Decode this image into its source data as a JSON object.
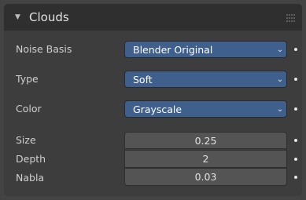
{
  "panel": {
    "title": "Clouds",
    "collapse_icon": "triangle-down-icon",
    "drag_icon": "grip-dots-icon"
  },
  "rows": {
    "noise_basis": {
      "label": "Noise Basis",
      "value": "Blender Original"
    },
    "type": {
      "label": "Type",
      "value": "Soft"
    },
    "color": {
      "label": "Color",
      "value": "Grayscale"
    },
    "size": {
      "label": "Size",
      "value": "0.25"
    },
    "depth": {
      "label": "Depth",
      "value": "2"
    },
    "nabla": {
      "label": "Nabla",
      "value": "0.03"
    }
  },
  "glyphs": {
    "collapse": "▼",
    "caret": "⌄"
  },
  "colors": {
    "dropdown_bg": "#3f5f8c",
    "field_bg": "#545454",
    "panel_bg": "#3d3d3d",
    "header_bg": "#2f2f2f"
  }
}
